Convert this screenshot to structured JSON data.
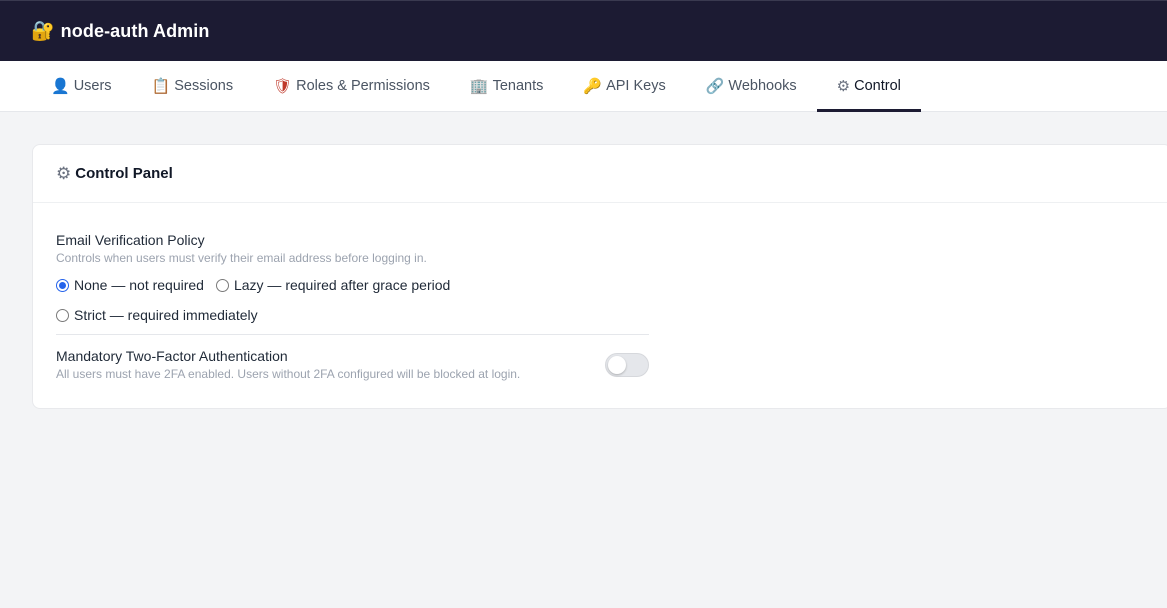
{
  "header": {
    "logo_icon": "lock-with-key-icon",
    "logo_glyph": "🔐",
    "title": "node-auth Admin"
  },
  "tabs": [
    {
      "label": "Users",
      "icon": "user-icon",
      "glyph": "👤",
      "active": false
    },
    {
      "label": "Sessions",
      "icon": "notepad-icon",
      "glyph": "📋",
      "active": false
    },
    {
      "label": "Roles & Permissions",
      "icon": "shield-icon",
      "glyph": "🛡",
      "active": false
    },
    {
      "label": "Tenants",
      "icon": "building-icon",
      "glyph": "🏢",
      "active": false
    },
    {
      "label": "API Keys",
      "icon": "key-icon",
      "glyph": "🔑",
      "active": false
    },
    {
      "label": "Webhooks",
      "icon": "link-icon",
      "glyph": "🔗",
      "active": false
    },
    {
      "label": "Control",
      "icon": "gear-icon",
      "glyph": "⚙",
      "active": true
    }
  ],
  "panel": {
    "icon": "gear-icon",
    "glyph": "⚙",
    "title": "Control Panel",
    "email_policy": {
      "label": "Email Verification Policy",
      "description": "Controls when users must verify their email address before logging in.",
      "options": [
        {
          "label": "None — not required",
          "checked": true
        },
        {
          "label": "Lazy — required after grace period",
          "checked": false
        },
        {
          "label": "Strict — required immediately",
          "checked": false
        }
      ]
    },
    "mandatory_2fa": {
      "label": "Mandatory Two-Factor Authentication",
      "description": "All users must have 2FA enabled. Users without 2FA configured will be blocked at login.",
      "enabled": false
    }
  },
  "colors": {
    "topbar": "#1c1b33",
    "accent": "#2563eb",
    "page_bg": "#f3f4f6"
  }
}
